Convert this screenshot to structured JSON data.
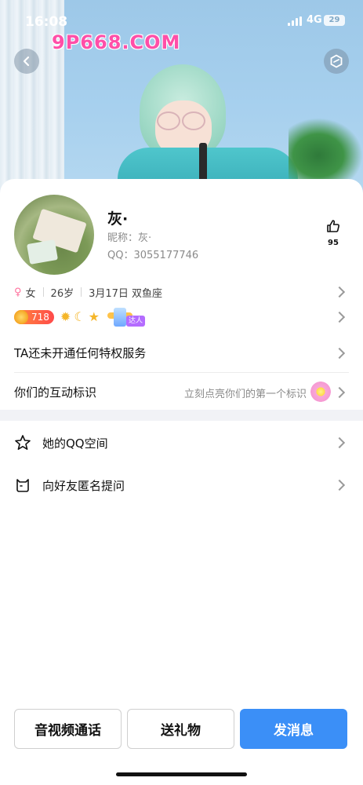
{
  "status_bar": {
    "time": "16:08",
    "network": "4G",
    "battery": "29"
  },
  "watermark": "9P668.COM",
  "header": {
    "back_icon": "chevron-left-icon",
    "shield_icon": "hexagon-shield-icon"
  },
  "profile": {
    "name": "灰·",
    "nickname": "昵称：灰·",
    "qq": "QQ：3055177746",
    "like_count": "95",
    "gender": "女",
    "age": "26岁",
    "birthday": "3月17日 双鱼座",
    "level": "718",
    "daren_label": "达人"
  },
  "menu": {
    "vip_text": "TA还未开通任何特权服务",
    "interact_label": "你们的互动标识",
    "interact_hint": "立刻点亮你们的第一个标识",
    "qzone_label": "她的QQ空间",
    "ask_label": "向好友匿名提问"
  },
  "actions": {
    "call": "音视频通话",
    "gift": "送礼物",
    "message": "发消息"
  },
  "colors": {
    "primary": "#3b8ff7",
    "female": "#ff6f9c",
    "watermark": "#ff4fa8"
  }
}
